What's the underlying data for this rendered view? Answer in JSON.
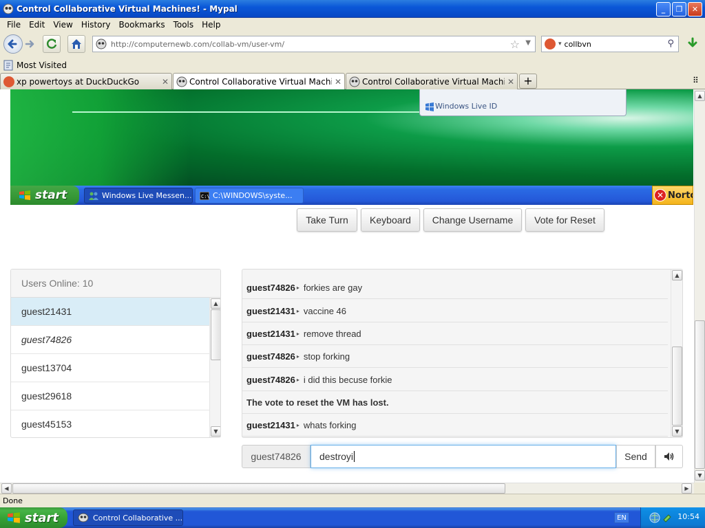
{
  "window": {
    "title": "Control Collaborative Virtual Machines! - Mypal",
    "buttons": {
      "minimize": "_",
      "maximize": "❐",
      "close": "✕"
    }
  },
  "menu": [
    "File",
    "Edit",
    "View",
    "History",
    "Bookmarks",
    "Tools",
    "Help"
  ],
  "navbar": {
    "url": "http://computernewb.com/collab-vm/user-vm/",
    "search_query": "collbvn"
  },
  "bookmarks": {
    "most_visited": "Most Visited"
  },
  "tabs": [
    {
      "label": "xp powertoys at DuckDuckGo",
      "active": false
    },
    {
      "label": "Control Collaborative Virtual Machines!",
      "active": true
    },
    {
      "label": "Control Collaborative Virtual Machines!",
      "active": false
    }
  ],
  "vm": {
    "popup_label": "Windows Live ID",
    "start_label": "start",
    "tasks": [
      "Windows Live Messen...",
      "C:\\WINDOWS\\syste..."
    ],
    "norton_label": "Norto"
  },
  "controls": [
    "Take Turn",
    "Keyboard",
    "Change Username",
    "Vote for Reset"
  ],
  "users": {
    "header": "Users Online: 10",
    "list": [
      {
        "name": "guest21431",
        "style": "self"
      },
      {
        "name": "guest74826",
        "style": "italic"
      },
      {
        "name": "guest13704",
        "style": "normal"
      },
      {
        "name": "guest29618",
        "style": "normal"
      },
      {
        "name": "guest45153",
        "style": "normal"
      }
    ]
  },
  "chat": {
    "messages": [
      {
        "user": "guest74826",
        "text": "forkies are gay"
      },
      {
        "user": "guest21431",
        "text": "vaccine 46"
      },
      {
        "user": "guest21431",
        "text": "remove thread"
      },
      {
        "user": "guest74826",
        "text": "stop forking"
      },
      {
        "user": "guest74826",
        "text": "i did this becuse forkie"
      },
      {
        "user": "",
        "text": "The vote to reset the VM has lost."
      },
      {
        "user": "guest21431",
        "text": "whats forking"
      }
    ],
    "username": "guest74826",
    "input_value": "destroyi",
    "send_label": "Send"
  },
  "status": {
    "text": "Done"
  },
  "taskbar": {
    "start_label": "start",
    "task_label": "Control Collaborative ...",
    "lang": "EN",
    "clock": "10:54"
  },
  "colors": {
    "xp_blue": "#2157d7",
    "start_green": "#36a336",
    "selected_user_bg": "#d9edf7",
    "input_focus": "#66afe9"
  }
}
